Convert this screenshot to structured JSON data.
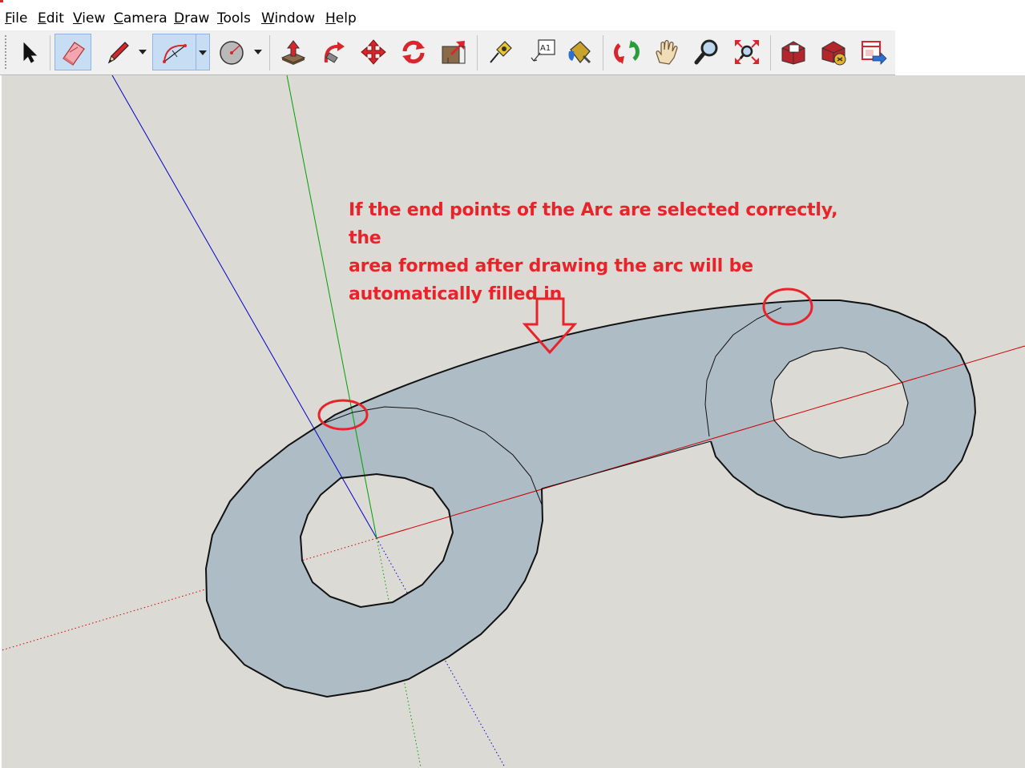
{
  "menu": {
    "items": [
      {
        "mnemonic": "F",
        "rest": "ile"
      },
      {
        "mnemonic": "E",
        "rest": "dit"
      },
      {
        "mnemonic": "V",
        "rest": "iew"
      },
      {
        "mnemonic": "C",
        "rest": "amera"
      },
      {
        "mnemonic": "D",
        "rest": "raw"
      },
      {
        "mnemonic": "T",
        "rest": "ools"
      },
      {
        "mnemonic": "W",
        "rest": "indow"
      },
      {
        "mnemonic": "H",
        "rest": "elp"
      }
    ]
  },
  "toolbar": {
    "active_tools": [
      "eraser",
      "arc"
    ],
    "tools": [
      {
        "name": "select-tool",
        "icon": "arrow-cursor-icon"
      },
      {
        "name": "eraser-tool",
        "icon": "eraser-icon"
      },
      {
        "name": "pencil-tool",
        "icon": "pencil-icon"
      },
      {
        "name": "arc-tool",
        "icon": "arc-icon"
      },
      {
        "name": "circle-tool",
        "icon": "circle-icon"
      },
      {
        "name": "push-pull-tool",
        "icon": "push-pull-icon"
      },
      {
        "name": "follow-me-tool",
        "icon": "follow-me-icon"
      },
      {
        "name": "move-tool",
        "icon": "move-icon"
      },
      {
        "name": "rotate-tool",
        "icon": "rotate-icon"
      },
      {
        "name": "scale-tool",
        "icon": "scale-icon"
      },
      {
        "name": "tape-measure-tool",
        "icon": "tape-measure-icon"
      },
      {
        "name": "text-tool",
        "icon": "text-icon"
      },
      {
        "name": "paint-bucket-tool",
        "icon": "paint-bucket-icon"
      },
      {
        "name": "orbit-tool",
        "icon": "orbit-icon"
      },
      {
        "name": "pan-tool",
        "icon": "hand-icon"
      },
      {
        "name": "zoom-tool",
        "icon": "magnifier-icon"
      },
      {
        "name": "zoom-extents-tool",
        "icon": "zoom-extents-icon"
      },
      {
        "name": "warehouse-tool",
        "icon": "warehouse-icon"
      },
      {
        "name": "extension-warehouse-tool",
        "icon": "extension-warehouse-icon"
      },
      {
        "name": "send-to-layout-tool",
        "icon": "send-to-layout-icon"
      }
    ],
    "text_tool_label": "A1"
  },
  "annotation": {
    "text": "If the end points of the Arc are selected correctly, the\narea formed after drawing the arc will be\nautomatically filled in",
    "color": "#e8232a"
  },
  "scene": {
    "background": "#dcdad5",
    "face_color": "#aebcc6",
    "axis_colors": {
      "red": "#cc0000",
      "green": "#00a000",
      "blue": "#0000cc"
    }
  }
}
